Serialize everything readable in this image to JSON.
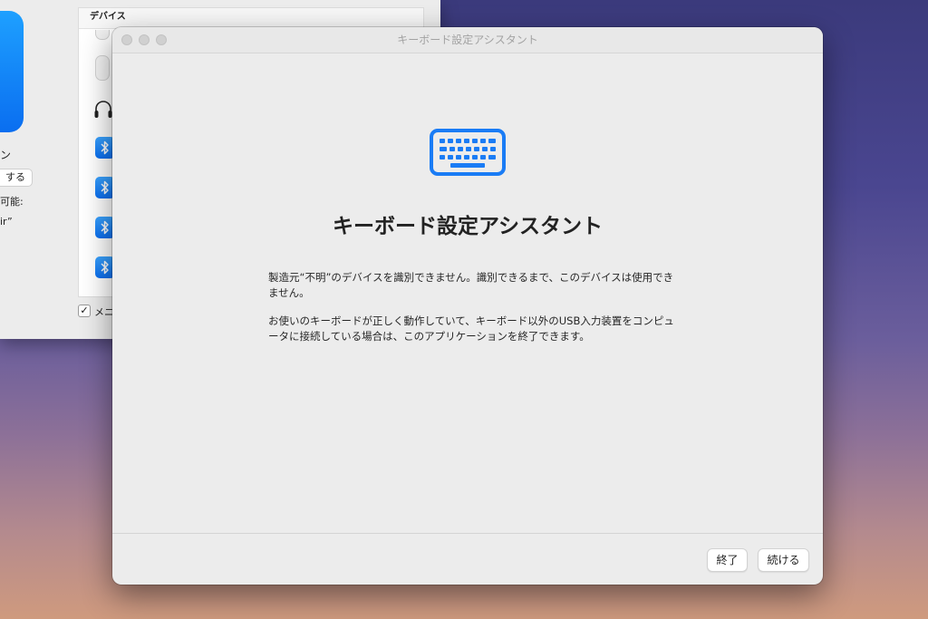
{
  "background_window": {
    "partial_name": "ン",
    "partial_button": "する",
    "partial_text1": "可能:",
    "partial_text2": "ir”",
    "device_list_header": "デバイス",
    "checkbox_mark": "✓",
    "checkbox_label": "メニ",
    "devices": [
      {
        "icon": "mouse-icon"
      },
      {
        "icon": "mouse-icon"
      },
      {
        "icon": "headphones-icon"
      },
      {
        "icon": "bluetooth-icon"
      },
      {
        "icon": "bluetooth-icon"
      },
      {
        "icon": "bluetooth-icon"
      },
      {
        "icon": "bluetooth-icon"
      }
    ]
  },
  "dialog": {
    "window_title": "キーボード設定アシスタント",
    "icon": "keyboard-icon",
    "heading": "キーボード設定アシスタント",
    "paragraph1": "製造元“不明”のデバイスを識別できません。識別できるまで、このデバイスは使用できません。",
    "paragraph2": "お使いのキーボードが正しく動作していて、キーボード以外のUSB入力装置をコンピュータに接続している場合は、このアプリケーションを終了できます。",
    "buttons": {
      "quit": "終了",
      "continue": "続ける"
    }
  },
  "colors": {
    "accent": "#1a7cf5",
    "desktop_top": "#3b3a7c",
    "desktop_bottom": "#cf9a7e"
  }
}
